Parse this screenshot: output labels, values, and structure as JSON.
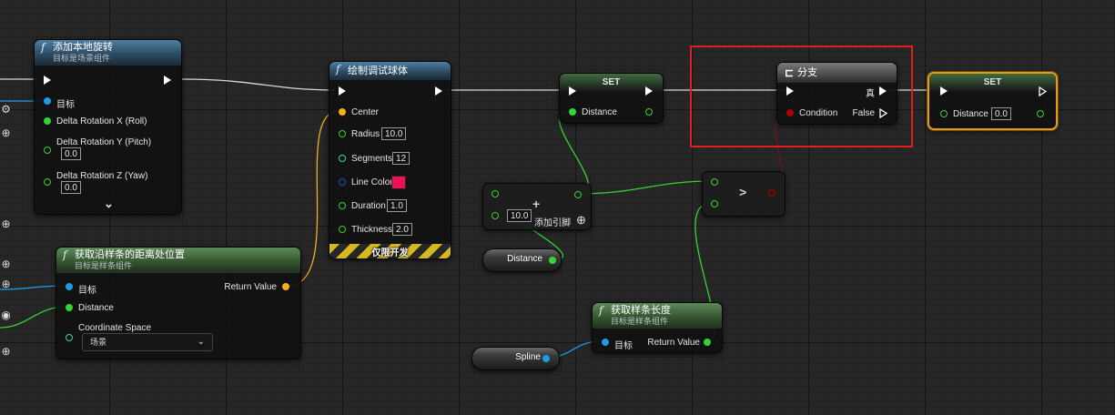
{
  "nodes": {
    "add_rotation": {
      "title": "添加本地旋转",
      "subtitle": "目标是场景组件",
      "target_label": "目标",
      "roll_label": "Delta Rotation X (Roll)",
      "pitch_label": "Delta Rotation Y (Pitch)",
      "pitch_value": "0.0",
      "yaw_label": "Delta Rotation Z (Yaw)",
      "yaw_value": "0.0",
      "expand_glyph": "⌄"
    },
    "draw_sphere": {
      "title": "绘制调试球体",
      "center_label": "Center",
      "radius_label": "Radius",
      "radius_value": "10.0",
      "segments_label": "Segments",
      "segments_value": "12",
      "line_color_label": "Line Color",
      "duration_label": "Duration",
      "duration_value": "1.0",
      "thickness_label": "Thickness",
      "thickness_value": "2.0",
      "dev_only_label": "仅限开发"
    },
    "get_location": {
      "title": "获取沿样条的距离处位置",
      "subtitle": "目标是样条组件",
      "target_label": "目标",
      "distance_label": "Distance",
      "coord_label": "Coordinate Space",
      "coord_value": "场景",
      "return_label": "Return Value"
    },
    "set1": {
      "title": "SET",
      "distance_label": "Distance"
    },
    "branch": {
      "title": "分支",
      "true_label": "真",
      "condition_label": "Condition",
      "false_label": "False"
    },
    "set2": {
      "title": "SET",
      "distance_label": "Distance",
      "distance_value": "0.0"
    },
    "add": {
      "op": "+",
      "value": "10.0",
      "add_pin_label": "添加引脚"
    },
    "distance_var": {
      "label": "Distance"
    },
    "greater": {
      "op": ">"
    },
    "spline_length": {
      "title": "获取样条长度",
      "subtitle": "目标是样条组件",
      "target_label": "目标",
      "return_label": "Return Value"
    },
    "spline_var": {
      "label": "Spline"
    }
  },
  "colors": {
    "exec": "#ffffff",
    "object_pin": "#1e9be8",
    "float_pin": "#36d336",
    "struct_pin": "#f0b020",
    "bool_pin": "#b00000",
    "int_pin": "#2fd6b0",
    "color_pin": "#2050c8",
    "line_color_value": "#ee1155",
    "selection": "#e39b1f",
    "highlight_box": "#e02020"
  },
  "icons": {
    "function": "function-icon",
    "branch": "branch-icon",
    "gear": "gear-icon",
    "plus_circle": "plus-circle-icon",
    "eye": "eye-icon"
  }
}
